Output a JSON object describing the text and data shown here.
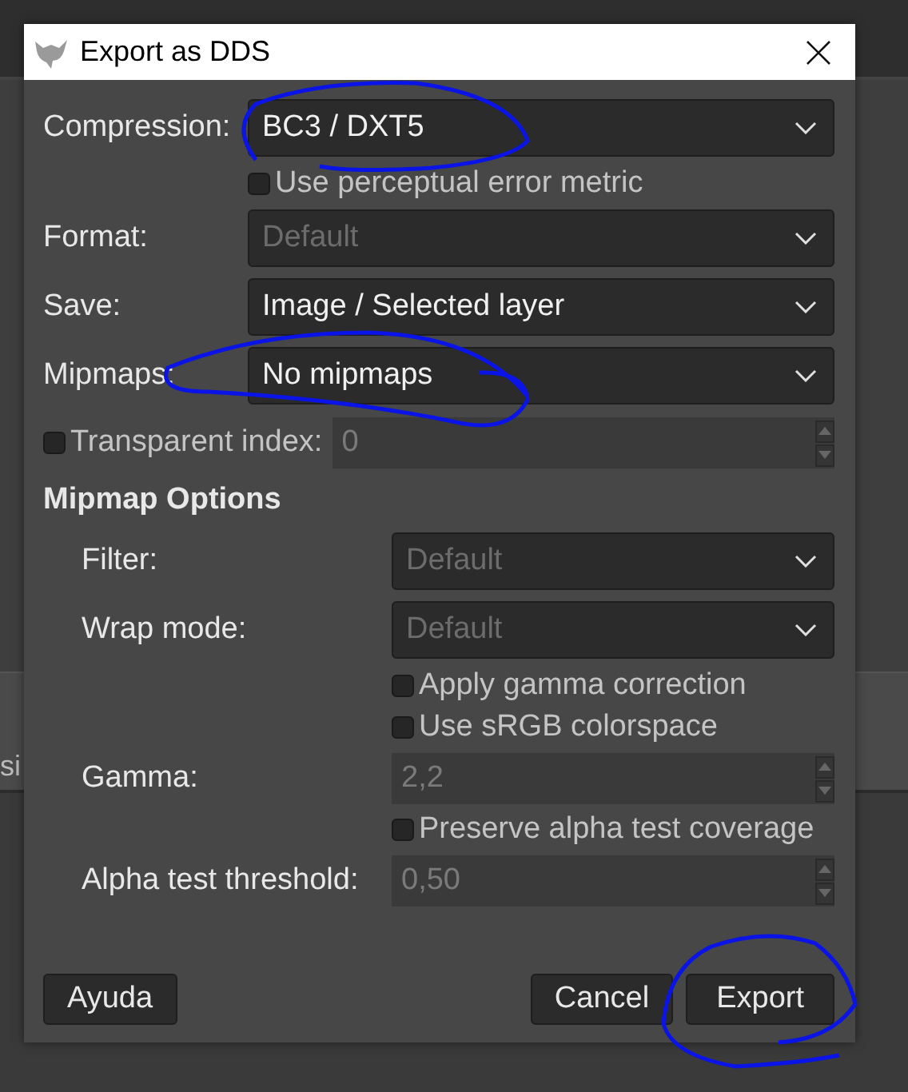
{
  "background": {
    "side_text": "si"
  },
  "window": {
    "title": "Export as DDS"
  },
  "settings": [
    {
      "kind": "dropdown",
      "label": "Compression:",
      "value": "BC3 / DXT5",
      "disabled": false
    },
    {
      "kind": "checkbox",
      "label": "Use perceptual error metric",
      "checked": false
    },
    {
      "kind": "dropdown",
      "label": "Format:",
      "value": "Default",
      "disabled": true
    },
    {
      "kind": "dropdown",
      "label": "Save:",
      "value": "Image / Selected layer",
      "disabled": false
    },
    {
      "kind": "dropdown",
      "label": "Mipmaps:",
      "value": "No mipmaps",
      "disabled": false
    },
    {
      "kind": "checkspin",
      "label": "Transparent index:",
      "checked": false,
      "value": "0",
      "disabled": true
    }
  ],
  "mipmap_options": {
    "title": "Mipmap Options",
    "items": [
      {
        "kind": "dropdown",
        "label": "Filter:",
        "value": "Default",
        "disabled": true
      },
      {
        "kind": "dropdown",
        "label": "Wrap mode:",
        "value": "Default",
        "disabled": true
      },
      {
        "kind": "checkbox",
        "label": "Apply gamma correction",
        "checked": false
      },
      {
        "kind": "checkbox",
        "label": "Use sRGB colorspace",
        "checked": false
      },
      {
        "kind": "spin",
        "label": "Gamma:",
        "value": "2,2",
        "disabled": true
      },
      {
        "kind": "checkbox",
        "label": "Preserve alpha test coverage",
        "checked": false
      },
      {
        "kind": "spin",
        "label": "Alpha test threshold:",
        "value": "0,50",
        "disabled": true
      }
    ]
  },
  "buttons": {
    "help": "Ayuda",
    "actions": [
      "Cancel",
      "Export"
    ]
  }
}
